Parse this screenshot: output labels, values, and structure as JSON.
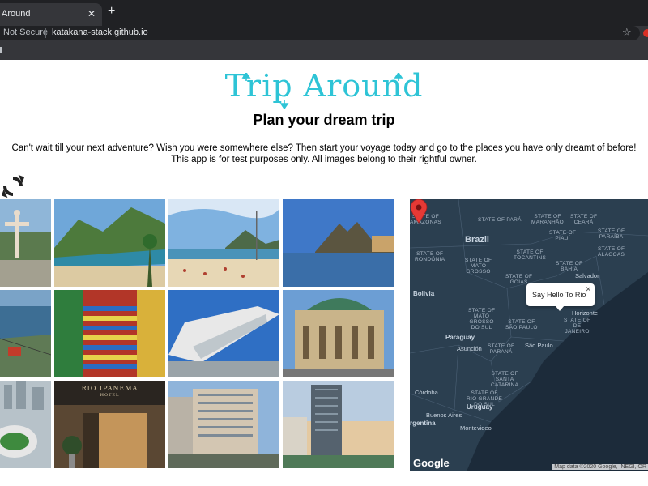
{
  "browser": {
    "tab_title": "Around",
    "tab_close": "✕",
    "new_tab": "+",
    "security_label": "Not Secure",
    "url": "katakana-stack.github.io",
    "bookmark_icon": "star-icon"
  },
  "page": {
    "logo_text": "Trip Around",
    "headline": "Plan your dream trip",
    "description_line1": "Can't wait till your next adventure? Wish you were somewhere else? Then start your voyage today and go to the places you have only dreamt of before!",
    "description_line2": "This app is for test purposes only. All images belong to their rightful owner.",
    "refresh_icon": "refresh-icon"
  },
  "photos": [
    {
      "name": "christ-the-redeemer"
    },
    {
      "name": "beach-hills"
    },
    {
      "name": "copacabana-beach"
    },
    {
      "name": "ipanema-sunset"
    },
    {
      "name": "rio-aerial-cablecar"
    },
    {
      "name": "selaron-steps"
    },
    {
      "name": "museum-of-tomorrow"
    },
    {
      "name": "theatro-municipal"
    },
    {
      "name": "maracana-stadium"
    },
    {
      "name": "hotel-ipanema-entrance",
      "sign": "RIO IPANEMA",
      "sub": "HOTEL"
    },
    {
      "name": "hotel-tower"
    },
    {
      "name": "beachfront-tower"
    }
  ],
  "map": {
    "info_window_text": "Say Hello To Rio",
    "info_window_close": "✕",
    "google_logo": "Google",
    "attribution": "Map data ©2020 Google, INEGI, OR",
    "country_labels": [
      "Brazil",
      "Bolivia",
      "Paraguay",
      "Uruguay"
    ],
    "state_labels": [
      "STATE OF\nAMAZONAS",
      "STATE OF PARÁ",
      "STATE OF\nMARANHÃO",
      "STATE OF\nCEARÁ",
      "STATE OF\nPIAUÍ",
      "STATE OF\nPARAÍBA",
      "STATE OF\nTOCANTINS",
      "STATE OF\nALAGOAS",
      "STATE OF\nRONDÔNIA",
      "STATE OF\nMATO\nGROSSO",
      "STATE OF\nBAHIA",
      "STATE OF\nGOIÁS",
      "STATE OF\nMATO\nGROSSO\nDO SUL",
      "STATE OF\nSÃO PAULO",
      "STATE OF\nPARANÁ",
      "STATE OF\nSANTA\nCATARINA",
      "STATE OF\nRIO GRANDE\nDO SUL",
      "Horizonte",
      "STATE OF\nDE\nJANEIRO"
    ],
    "cities": [
      "Salvador",
      "Asunción",
      "São Paulo",
      "Córdoba",
      "Buenos Aires",
      "Montevideo"
    ],
    "partial_label": "rgentina",
    "colors": {
      "water": "#1c2b3a",
      "land": "#2b3f50",
      "border": "#4b6075",
      "pin": "#e53935"
    }
  }
}
